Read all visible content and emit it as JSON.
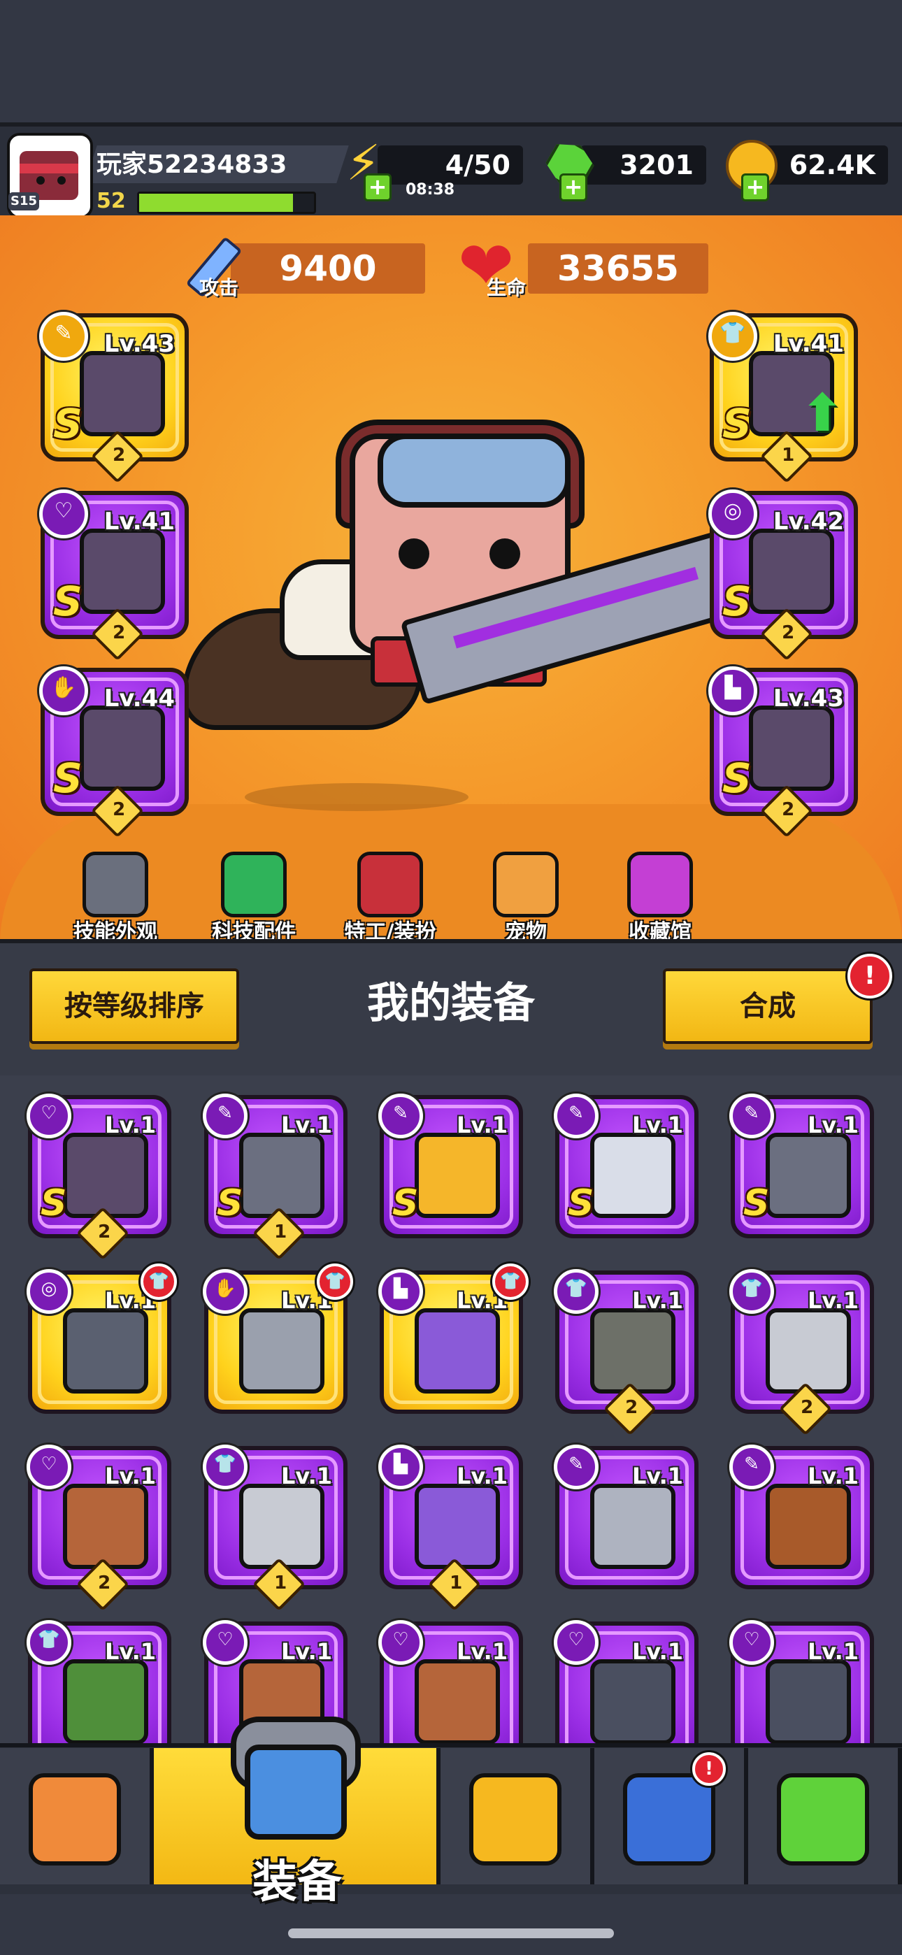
{
  "player": {
    "name": "玩家52234833",
    "level": "52",
    "season": "S15",
    "xp_progress": 0.88
  },
  "resources": {
    "energy": "4/50",
    "energy_timer": "08:38",
    "gems": "3201",
    "gold": "62.4K"
  },
  "power": {
    "attack_label": "攻击",
    "attack_value": "9400",
    "hp_label": "生命",
    "hp_value": "33655"
  },
  "equipped": [
    {
      "slot": "weapon",
      "level": "Lv.43",
      "rank": "S",
      "stars": "2",
      "rarity": "gold",
      "icon": "weapon-icon"
    },
    {
      "slot": "necklace",
      "level": "Lv.41",
      "rank": "S",
      "stars": "2",
      "rarity": "purple",
      "icon": "necklace-icon"
    },
    {
      "slot": "gloves",
      "level": "Lv.44",
      "rank": "S",
      "stars": "2",
      "rarity": "purple",
      "icon": "glove-icon"
    },
    {
      "slot": "armor",
      "level": "Lv.41",
      "rank": "S",
      "stars": "1",
      "rarity": "gold",
      "icon": "armor-icon",
      "upgrade": true
    },
    {
      "slot": "belt",
      "level": "Lv.42",
      "rank": "S",
      "stars": "2",
      "rarity": "purple",
      "icon": "belt-icon"
    },
    {
      "slot": "boots",
      "level": "Lv.43",
      "rank": "S",
      "stars": "2",
      "rarity": "purple",
      "icon": "boot-icon"
    }
  ],
  "submenu": [
    {
      "label": "技能外观",
      "icon": "skill-skin-icon",
      "color": "#6a6f7d"
    },
    {
      "label": "科技配件",
      "icon": "tech-part-icon",
      "color": "#2fb35a"
    },
    {
      "label": "特工/装扮",
      "icon": "agent-icon",
      "color": "#c8303a"
    },
    {
      "label": "宠物",
      "icon": "pet-icon",
      "color": "#f0a040"
    },
    {
      "label": "收藏馆",
      "icon": "collection-icon",
      "color": "#c43fd4"
    }
  ],
  "equipment_panel": {
    "title": "我的装备",
    "sort_label": "按等级排序",
    "merge_label": "合成",
    "merge_alert": "!"
  },
  "inventory": [
    {
      "level": "Lv.1",
      "rank": "S",
      "stars": "2",
      "rarity": "purple",
      "icon": "necklace-icon",
      "art_color": "#5a4a6a"
    },
    {
      "level": "Lv.1",
      "rank": "S",
      "stars": "1",
      "rarity": "purple",
      "icon": "weapon-icon",
      "art_color": "#6b6f80"
    },
    {
      "level": "Lv.1",
      "rank": "S",
      "stars": "",
      "rarity": "purple",
      "icon": "sword-icon",
      "art_color": "#f5b62a"
    },
    {
      "level": "Lv.1",
      "rank": "S",
      "stars": "",
      "rarity": "purple",
      "icon": "gun-icon",
      "art_color": "#d9dde8"
    },
    {
      "level": "Lv.1",
      "rank": "S",
      "stars": "",
      "rarity": "purple",
      "icon": "weapon-icon",
      "art_color": "#6b6f80"
    },
    {
      "level": "Lv.1",
      "rank": "",
      "stars": "",
      "rarity": "gold",
      "icon": "belt-icon",
      "art_color": "#5a6070",
      "new": true
    },
    {
      "level": "Lv.1",
      "rank": "",
      "stars": "",
      "rarity": "gold",
      "icon": "glove-icon",
      "art_color": "#9aa0ad",
      "new": true
    },
    {
      "level": "Lv.1",
      "rank": "",
      "stars": "",
      "rarity": "gold",
      "icon": "boot-icon",
      "art_color": "#8a5ad8",
      "new": true
    },
    {
      "level": "Lv.1",
      "rank": "",
      "stars": "2",
      "rarity": "purple",
      "icon": "armor-icon",
      "art_color": "#6d7068"
    },
    {
      "level": "Lv.1",
      "rank": "",
      "stars": "2",
      "rarity": "purple",
      "icon": "armor-icon",
      "art_color": "#c8cbd3"
    },
    {
      "level": "Lv.1",
      "rank": "",
      "stars": "2",
      "rarity": "purple",
      "icon": "necklace-icon",
      "art_color": "#b5653a"
    },
    {
      "level": "Lv.1",
      "rank": "",
      "stars": "1",
      "rarity": "purple",
      "icon": "armor-icon",
      "art_color": "#c8cbd3"
    },
    {
      "level": "Lv.1",
      "rank": "",
      "stars": "1",
      "rarity": "purple",
      "icon": "boot-icon",
      "art_color": "#8a5ad8"
    },
    {
      "level": "Lv.1",
      "rank": "",
      "stars": "",
      "rarity": "purple",
      "icon": "kunai-icon",
      "art_color": "#aeb3c0"
    },
    {
      "level": "Lv.1",
      "rank": "",
      "stars": "",
      "rarity": "purple",
      "icon": "shotgun-icon",
      "art_color": "#a85a2a"
    },
    {
      "level": "Lv.1",
      "rank": "",
      "stars": "",
      "rarity": "purple",
      "icon": "armor-icon",
      "art_color": "#4f8f3a"
    },
    {
      "level": "Lv.1",
      "rank": "",
      "stars": "",
      "rarity": "purple",
      "icon": "necklace-icon",
      "art_color": "#b5653a"
    },
    {
      "level": "Lv.1",
      "rank": "",
      "stars": "",
      "rarity": "purple",
      "icon": "necklace-icon",
      "art_color": "#b5653a"
    },
    {
      "level": "Lv.1",
      "rank": "",
      "stars": "",
      "rarity": "purple",
      "icon": "necklace-icon",
      "art_color": "#4a4f60"
    },
    {
      "level": "Lv.1",
      "rank": "",
      "stars": "",
      "rarity": "purple",
      "icon": "necklace-icon",
      "art_color": "#4a4f60"
    }
  ],
  "bottom_nav": {
    "equip_label": "装备",
    "items": [
      {
        "icon": "shop-icon",
        "color": "#f08a3a"
      },
      {
        "icon": "equipment-icon",
        "color": "#4b8fe0",
        "active": true
      },
      {
        "icon": "star-swords-icon",
        "color": "#f6b81f"
      },
      {
        "icon": "globe-icon",
        "color": "#3a6fd8",
        "alert": "!"
      },
      {
        "icon": "dna-capsule-icon",
        "color": "#5fd23a"
      }
    ]
  },
  "colors": {
    "hero_bg": "#f59a2b",
    "gold_rarity": "#ffd21c",
    "purple_rarity": "#9a2ee5",
    "accent_button": "#f2b714"
  }
}
